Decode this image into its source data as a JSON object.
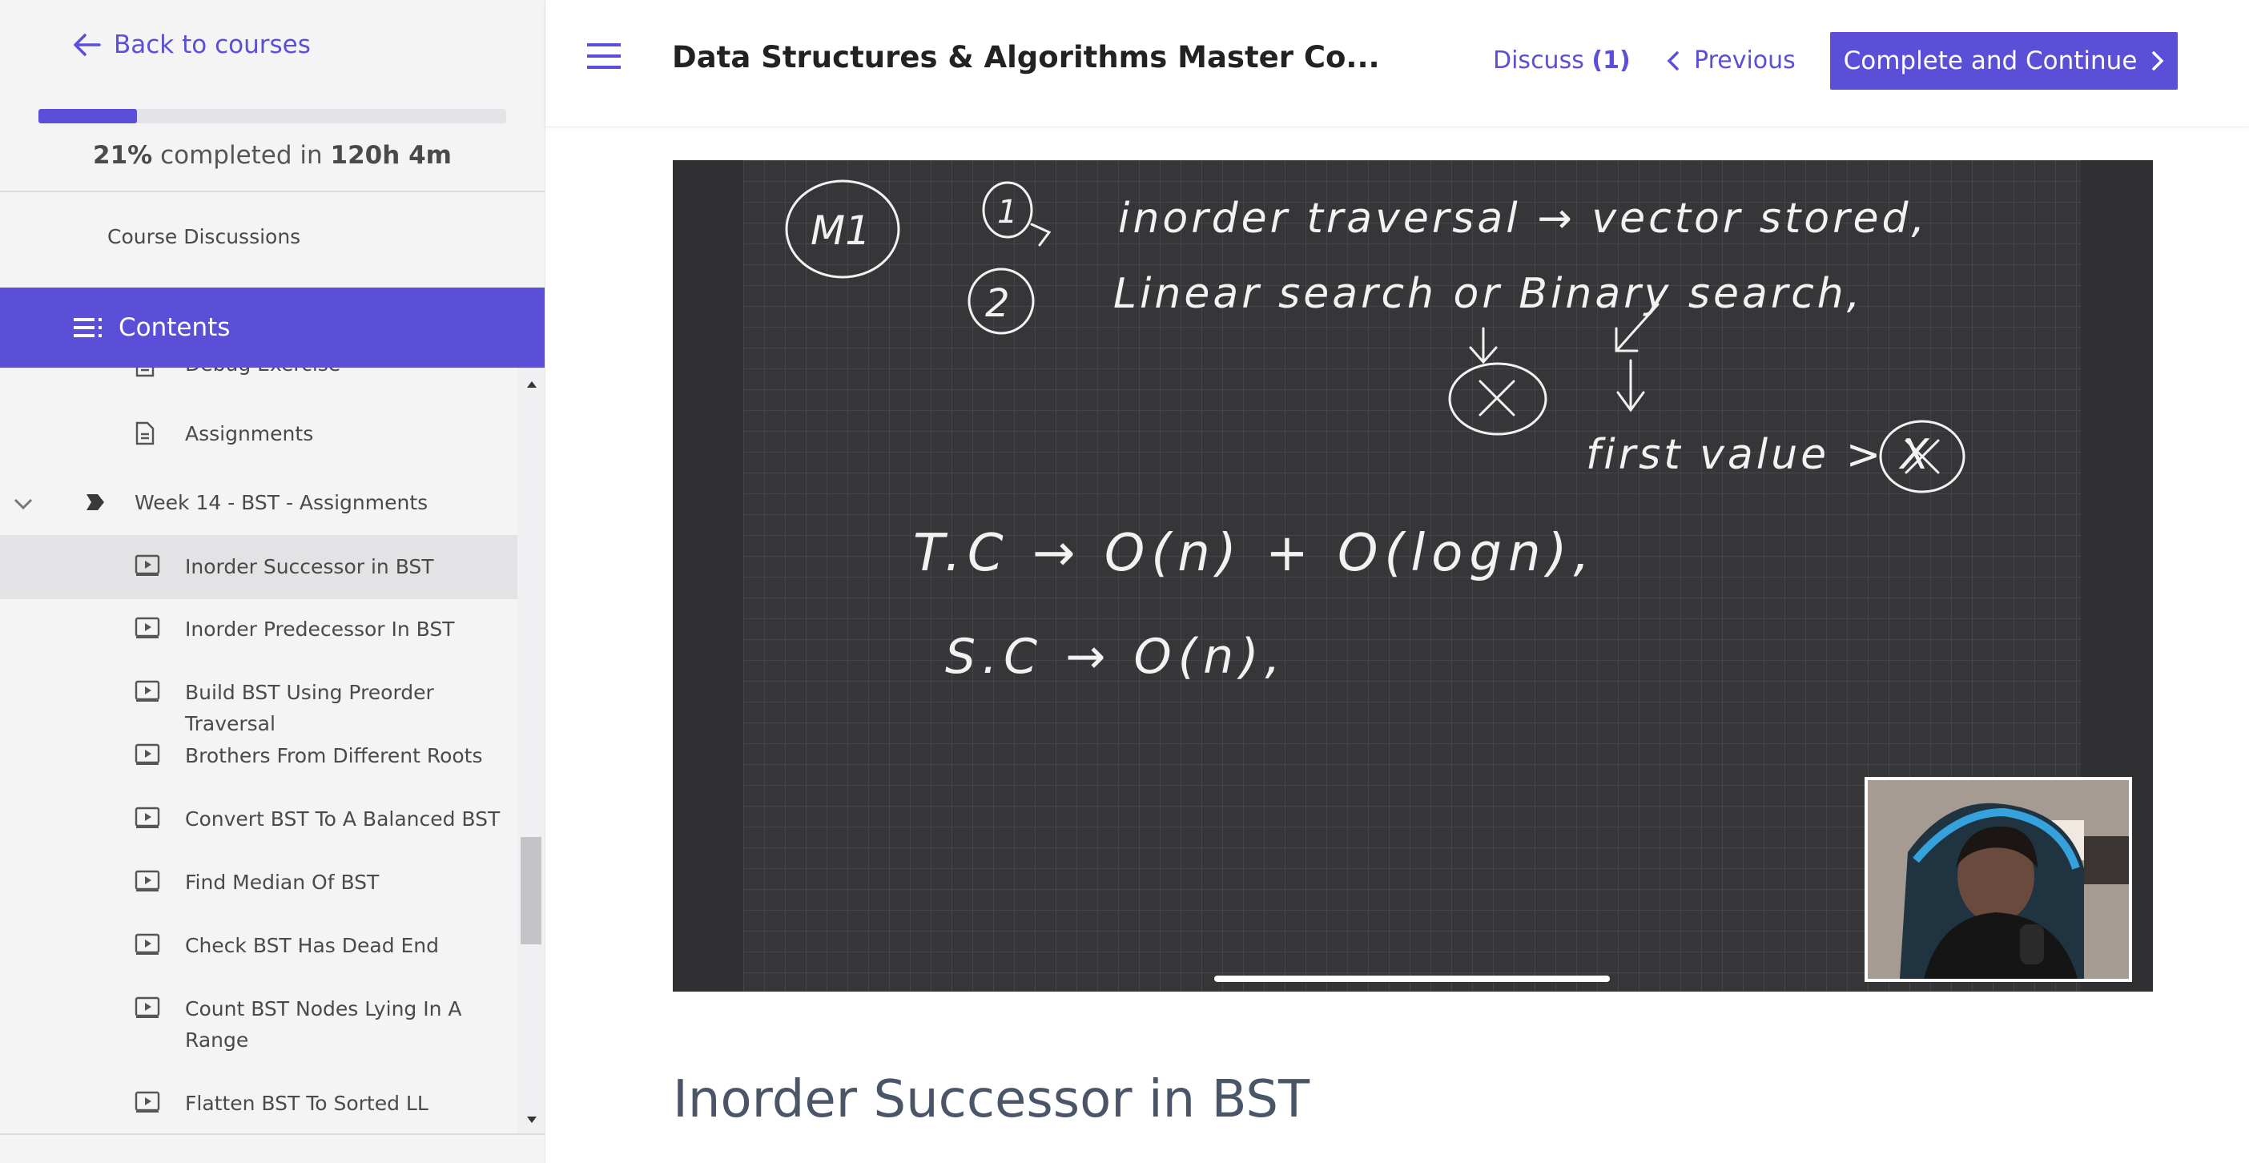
{
  "sidebar": {
    "back_label": "Back to courses",
    "progress": {
      "fraction": 0.21,
      "percent_label": "21%",
      "completed_in": "completed in",
      "time_label": "120h 4m"
    },
    "discussions_label": "Course Discussions",
    "contents_label": "Contents",
    "items": [
      {
        "label": "Debug Exercise",
        "icon": "document-icon"
      },
      {
        "label": "Assignments",
        "icon": "document-icon"
      },
      {
        "label": "Week 14 - BST - Assignments",
        "icon": "chapter-tag-icon",
        "type": "section"
      },
      {
        "label": "Inorder Successor in BST",
        "icon": "video-icon",
        "active": true
      },
      {
        "label": "Inorder Predecessor In BST",
        "icon": "video-icon"
      },
      {
        "label": "Build BST Using Preorder Traversal",
        "icon": "video-icon"
      },
      {
        "label": "Brothers From Different Roots",
        "icon": "video-icon"
      },
      {
        "label": "Convert BST To A Balanced BST",
        "icon": "video-icon"
      },
      {
        "label": "Find Median Of BST",
        "icon": "video-icon"
      },
      {
        "label": "Check BST Has Dead End",
        "icon": "video-icon"
      },
      {
        "label": "Count BST Nodes Lying In A Range",
        "icon": "video-icon"
      },
      {
        "label": "Flatten BST To Sorted LL",
        "icon": "video-icon"
      }
    ]
  },
  "header": {
    "course_title": "Data Structures & Algorithms Master Co...",
    "discuss_label": "Discuss",
    "discuss_count": "(1)",
    "previous_label": "Previous",
    "complete_label": "Complete and Continue"
  },
  "video": {
    "notes": {
      "m1": "M1",
      "step1": "1",
      "step2": "2",
      "line1": "inorder traversal → vector stored,",
      "line2": "Linear search or Binary search,",
      "x_mark": "X",
      "line3": "first value > X",
      "tc": "T.C → O(n) + O(logn),",
      "sc": "S.C → O(n),"
    }
  },
  "lesson": {
    "title": "Inorder Successor in BST"
  },
  "colors": {
    "accent": "#5a4fd6",
    "sidebar_bg": "#f4f4f5",
    "active_row": "#e3e3e5"
  }
}
